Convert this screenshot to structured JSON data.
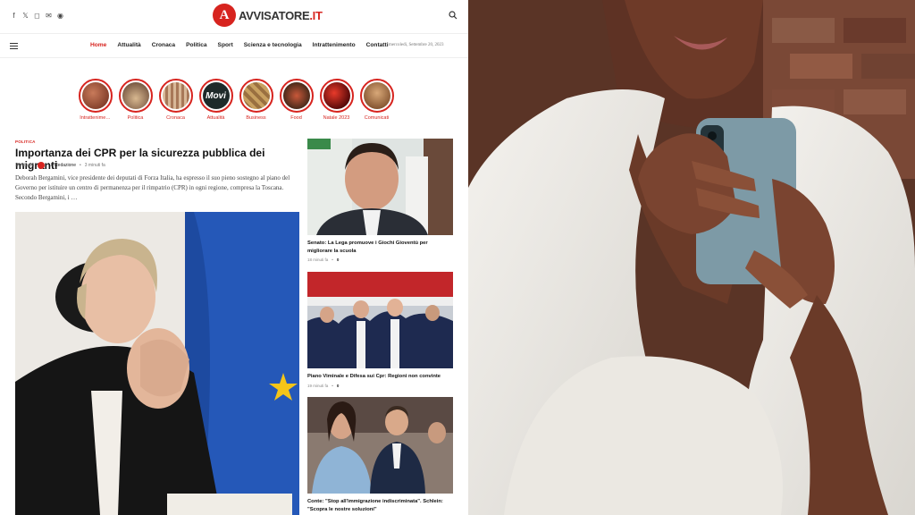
{
  "brand": {
    "mark": "A",
    "name_prefix": "AVVISATORE",
    "name_suffix": ".IT",
    "accent": "#d7241f"
  },
  "social": [
    {
      "icon": "facebook-icon",
      "glyph": "f"
    },
    {
      "icon": "x-icon",
      "glyph": "𝕏"
    },
    {
      "icon": "instagram-icon",
      "glyph": "◻"
    },
    {
      "icon": "email-icon",
      "glyph": "✉"
    },
    {
      "icon": "rss-icon",
      "glyph": "◉"
    }
  ],
  "nav": {
    "items": [
      "Home",
      "Attualità",
      "Cronaca",
      "Politica",
      "Sport",
      "Scienza e tecnologia",
      "Intrattenimento",
      "Contatti"
    ],
    "active": "Home",
    "date": "mercoledì, Settembre 20, 2023"
  },
  "stories": [
    {
      "label": "Intrattenime…",
      "color": "#8a3a2a"
    },
    {
      "label": "Politica",
      "color": "#6a4a3a"
    },
    {
      "label": "Cronaca",
      "color": "#b08060"
    },
    {
      "label": "Attualità",
      "color": "#2a2a2a",
      "overlay": "Movi"
    },
    {
      "label": "Business",
      "color": "#b8944a"
    },
    {
      "label": "Food",
      "color": "#5a3a2a"
    },
    {
      "label": "Natale 2023",
      "color": "#7a1a1a"
    },
    {
      "label": "Comunicati",
      "color": "#9a5a30"
    }
  ],
  "main_article": {
    "category": "POLITICA",
    "title": "Importanza dei CPR per la sicurezza pubblica dei migranti",
    "written_by": "Scritto da",
    "author": "La Redazione",
    "time": "3 minuti fa",
    "excerpt": "Deborah Bergamini, vice presidente dei deputati di Forza Italia, ha espresso il suo pieno sostegno al piano del Governo per istituire un centro di permanenza per il rimpatrio (CPR) in ogni regione, compresa la Toscana. Secondo Bergamini, i …"
  },
  "side_articles": [
    {
      "title": "Senato: La Lega promuove i Giochi Gioventù per migliorare la scuola",
      "time": "18 minuti fa",
      "comments": "0"
    },
    {
      "title": "Piano Viminale e Difesa sui Cpr: Regioni non convinte",
      "time": "19 minuti fa",
      "comments": "0"
    },
    {
      "title": "Conte: \"Stop all'immigrazione indiscriminata\". Schlein: \"Scopra le nostre soluzioni\"",
      "time": "",
      "comments": ""
    }
  ]
}
